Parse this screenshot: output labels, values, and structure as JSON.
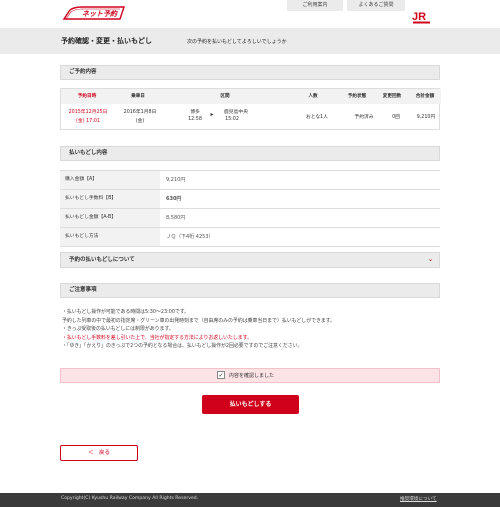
{
  "header": {
    "logo_text": "ネット予約",
    "links": [
      "ご利用案内",
      "よくあるご質問"
    ],
    "brand": "JR"
  },
  "title_bar": {
    "title": "予約確認・変更・払いもどし",
    "subtitle": "次の予約を払いもどしてよろしいでしょうか"
  },
  "reservation": {
    "heading": "ご予約内容",
    "columns": [
      "予約日時",
      "乗車日",
      "区間",
      "人数",
      "予約状態",
      "変更回数",
      "合計金額"
    ],
    "row": {
      "reserved_date": "2015年12月25日",
      "reserved_time": "(金) 17:01",
      "boarding_date": "2016年1月8日",
      "boarding_day": "(金)",
      "from_station": "博多",
      "from_time": "12:58",
      "to_station": "鹿児島中央",
      "to_time": "15:02",
      "passengers": "おとな1人",
      "status": "予約済み",
      "changes": "0回",
      "total": "9,210円"
    }
  },
  "refund": {
    "heading": "払いもどし内容",
    "rows": [
      {
        "label": "購入金額【A】",
        "value": "9,210円"
      },
      {
        "label": "払いもどし手数料【B】",
        "value": "630円"
      },
      {
        "label": "払いもどし金額【A-B】",
        "value": "8,580円"
      },
      {
        "label": "払いもどし方法",
        "value": "ＪＱ（下4桁 4253）"
      }
    ]
  },
  "accordion": {
    "label": "予約の払いもどしについて"
  },
  "notice": {
    "heading": "ご注意事項",
    "lines": [
      "・払いもどし操作が可能である時間は5:30～23:00です。",
      "予約した列車の中で最初の指定席・グリーン車の出発時刻まで（自由席のみの予約は乗車当日まで）払いもどしができます。",
      "・きっぷ受取後の払いもどしには制限があります。",
      "・払いもどし手数料を差し引いた上で、当社が指定する方法によりお返しいたします。",
      "・「ゆき」「かえり」のきっぷで2つの予約となる場合は、払いもどし操作が2回必要ですのでご注意ください。"
    ]
  },
  "confirm": {
    "check_mark": "✓",
    "label": "内容を確認しました"
  },
  "actions": {
    "primary": "払いもどしする",
    "back": "＜　戻る"
  },
  "footer": {
    "copyright": "Copyright(C) Kyushu Railway Company All Rights Reserved.",
    "link": "推奨環境について"
  },
  "colors": {
    "accent": "#d0021b",
    "panel": "#ebebeb",
    "confirm_bg": "#fbe3e6",
    "footer": "#3a3a3a"
  }
}
